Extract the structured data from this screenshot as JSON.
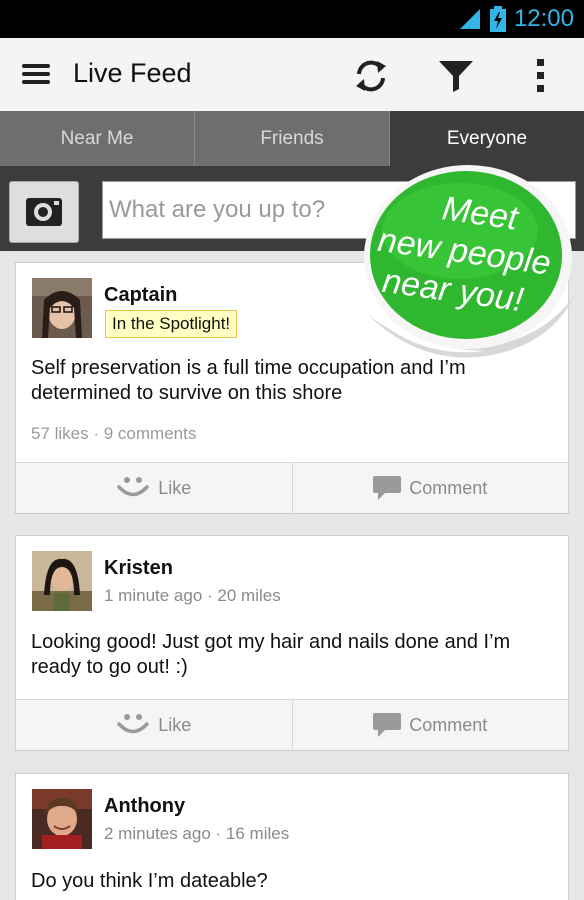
{
  "status_bar": {
    "time": "12:00"
  },
  "action_bar": {
    "title": "Live Feed"
  },
  "tabs": [
    {
      "label": "Near Me"
    },
    {
      "label": "Friends"
    },
    {
      "label": "Everyone"
    }
  ],
  "compose": {
    "placeholder": "What are you up to?"
  },
  "promo": {
    "line1": "Meet",
    "line2": "new people",
    "line3": "near you!"
  },
  "posts": [
    {
      "name": "Captain",
      "badge": "In the Spotlight!",
      "text": "Self preservation is a full time occupation and I’m determined to survive on this shore",
      "counts": "57 likes · 9 comments",
      "like_label": "Like",
      "comment_label": "Comment"
    },
    {
      "name": "Kristen",
      "meta": "1 minute ago · 20 miles",
      "text": "Looking good! Just got my hair and nails done and I’m ready to go out! :)",
      "like_label": "Like",
      "comment_label": "Comment"
    },
    {
      "name": "Anthony",
      "meta": "2 minutes ago · 16 miles",
      "text": "Do you think I’m dateable?"
    }
  ],
  "colors": {
    "accent": "#33b5e5",
    "promo_green": "#2fb82f",
    "tab_active": "#3c3c3c"
  }
}
